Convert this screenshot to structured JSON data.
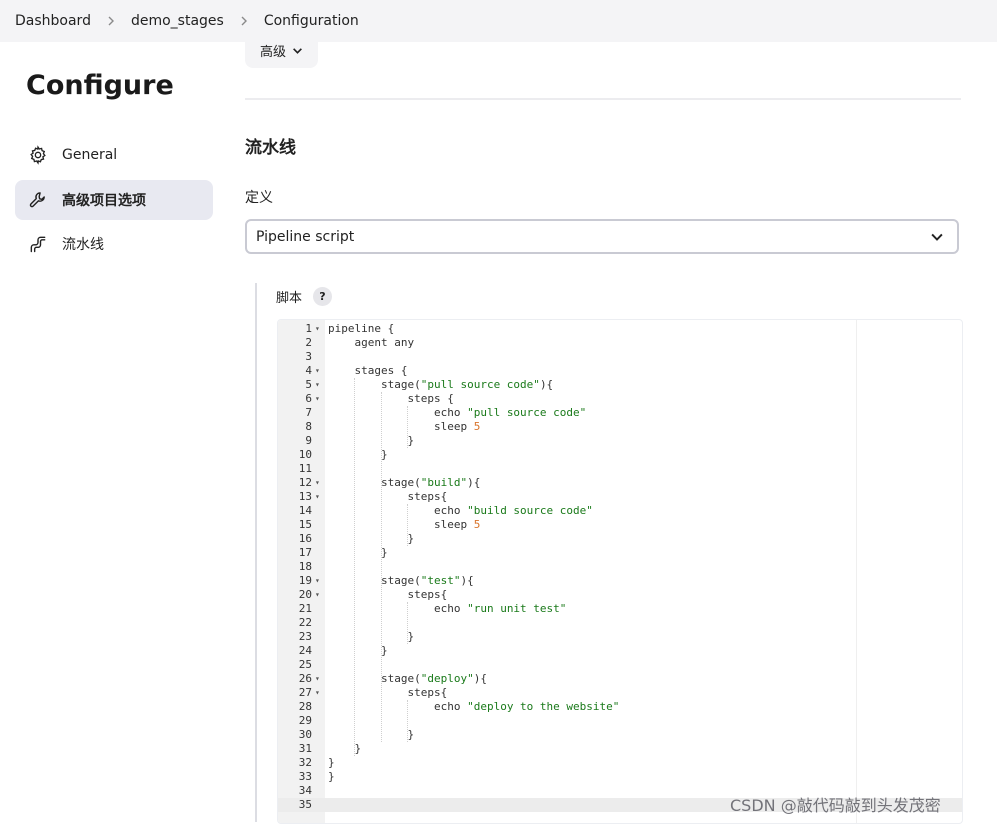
{
  "breadcrumb": {
    "items": [
      "Dashboard",
      "demo_stages",
      "Configuration"
    ]
  },
  "sidebar": {
    "title": "Configure",
    "items": [
      {
        "label": "General",
        "icon": "gear-icon",
        "active": false
      },
      {
        "label": "高级项目选项",
        "icon": "wrench-icon",
        "active": true
      },
      {
        "label": "流水线",
        "icon": "pipeline-icon",
        "active": false
      }
    ]
  },
  "main": {
    "advanced_button": "高级",
    "section_title": "流水线",
    "definition_label": "定义",
    "definition_value": "Pipeline script",
    "script_label": "脚本",
    "help_label": "?"
  },
  "editor": {
    "lines": [
      {
        "n": "1",
        "fold": true,
        "code": [
          [
            "t",
            "pipeline {"
          ]
        ]
      },
      {
        "n": "2",
        "fold": false,
        "code": [
          [
            "t",
            "    agent any"
          ]
        ]
      },
      {
        "n": "3",
        "fold": false,
        "code": [
          [
            "t",
            ""
          ]
        ]
      },
      {
        "n": "4",
        "fold": true,
        "code": [
          [
            "t",
            "    stages {"
          ]
        ]
      },
      {
        "n": "5",
        "fold": true,
        "code": [
          [
            "t",
            "        stage("
          ],
          [
            "s",
            "\"pull source code\""
          ],
          [
            "t",
            "){"
          ]
        ]
      },
      {
        "n": "6",
        "fold": true,
        "code": [
          [
            "t",
            "            steps {"
          ]
        ]
      },
      {
        "n": "7",
        "fold": false,
        "code": [
          [
            "t",
            "                echo "
          ],
          [
            "s",
            "\"pull source code\""
          ]
        ]
      },
      {
        "n": "8",
        "fold": false,
        "code": [
          [
            "t",
            "                sleep "
          ],
          [
            "n",
            "5"
          ]
        ]
      },
      {
        "n": "9",
        "fold": false,
        "code": [
          [
            "t",
            "            }"
          ]
        ]
      },
      {
        "n": "10",
        "fold": false,
        "code": [
          [
            "t",
            "        }"
          ]
        ]
      },
      {
        "n": "11",
        "fold": false,
        "code": [
          [
            "t",
            ""
          ]
        ]
      },
      {
        "n": "12",
        "fold": true,
        "code": [
          [
            "t",
            "        stage("
          ],
          [
            "s",
            "\"build\""
          ],
          [
            "t",
            "){"
          ]
        ]
      },
      {
        "n": "13",
        "fold": true,
        "code": [
          [
            "t",
            "            steps{"
          ]
        ]
      },
      {
        "n": "14",
        "fold": false,
        "code": [
          [
            "t",
            "                echo "
          ],
          [
            "s",
            "\"build source code\""
          ]
        ]
      },
      {
        "n": "15",
        "fold": false,
        "code": [
          [
            "t",
            "                sleep "
          ],
          [
            "n",
            "5"
          ]
        ]
      },
      {
        "n": "16",
        "fold": false,
        "code": [
          [
            "t",
            "            }"
          ]
        ]
      },
      {
        "n": "17",
        "fold": false,
        "code": [
          [
            "t",
            "        }"
          ]
        ]
      },
      {
        "n": "18",
        "fold": false,
        "code": [
          [
            "t",
            ""
          ]
        ]
      },
      {
        "n": "19",
        "fold": true,
        "code": [
          [
            "t",
            "        stage("
          ],
          [
            "s",
            "\"test\""
          ],
          [
            "t",
            "){"
          ]
        ]
      },
      {
        "n": "20",
        "fold": true,
        "code": [
          [
            "t",
            "            steps{"
          ]
        ]
      },
      {
        "n": "21",
        "fold": false,
        "code": [
          [
            "t",
            "                echo "
          ],
          [
            "s",
            "\"run unit test\""
          ]
        ]
      },
      {
        "n": "22",
        "fold": false,
        "code": [
          [
            "t",
            ""
          ]
        ]
      },
      {
        "n": "23",
        "fold": false,
        "code": [
          [
            "t",
            "            }"
          ]
        ]
      },
      {
        "n": "24",
        "fold": false,
        "code": [
          [
            "t",
            "        }"
          ]
        ]
      },
      {
        "n": "25",
        "fold": false,
        "code": [
          [
            "t",
            ""
          ]
        ]
      },
      {
        "n": "26",
        "fold": true,
        "code": [
          [
            "t",
            "        stage("
          ],
          [
            "s",
            "\"deploy\""
          ],
          [
            "t",
            "){"
          ]
        ]
      },
      {
        "n": "27",
        "fold": true,
        "code": [
          [
            "t",
            "            steps{"
          ]
        ]
      },
      {
        "n": "28",
        "fold": false,
        "code": [
          [
            "t",
            "                echo "
          ],
          [
            "s",
            "\"deploy to the website\""
          ]
        ]
      },
      {
        "n": "29",
        "fold": false,
        "code": [
          [
            "t",
            ""
          ]
        ]
      },
      {
        "n": "30",
        "fold": false,
        "code": [
          [
            "t",
            "            }"
          ]
        ]
      },
      {
        "n": "31",
        "fold": false,
        "code": [
          [
            "t",
            "    }"
          ]
        ]
      },
      {
        "n": "32",
        "fold": false,
        "code": [
          [
            "t",
            "}"
          ]
        ]
      },
      {
        "n": "33",
        "fold": false,
        "code": [
          [
            "t",
            "}"
          ]
        ]
      },
      {
        "n": "34",
        "fold": false,
        "code": [
          [
            "t",
            ""
          ]
        ]
      },
      {
        "n": "35",
        "fold": false,
        "code": [
          [
            "t",
            ""
          ]
        ],
        "active": true
      }
    ]
  },
  "watermark": "CSDN @敲代码敲到头发茂密",
  "colors": {
    "string": "#1a7a1a",
    "number": "#d9742b",
    "active_sidebar_bg": "#e8e9f1",
    "breadcrumb_bg": "#f4f4f6"
  }
}
